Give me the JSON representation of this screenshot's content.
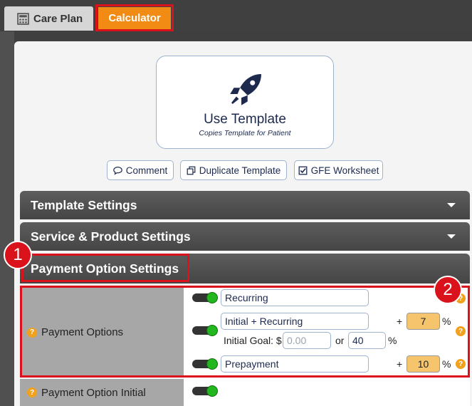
{
  "tabs": [
    {
      "label": "Care Plan",
      "icon": "calculator-icon"
    },
    {
      "label": "Calculator"
    }
  ],
  "template_card": {
    "title": "Use Template",
    "subtitle": "Copies Template for Patient",
    "icon": "rocket-icon"
  },
  "actions": [
    {
      "label": "Comment",
      "icon": "comment-icon"
    },
    {
      "label": "Duplicate Template",
      "icon": "copy-icon"
    },
    {
      "label": "GFE Worksheet",
      "icon": "checkbox-icon"
    }
  ],
  "sections": [
    {
      "label": "Template Settings"
    },
    {
      "label": "Service & Product Settings"
    },
    {
      "label": "Payment Option Settings"
    }
  ],
  "annotations": [
    "1",
    "2"
  ],
  "payment_options": {
    "label": "Payment Options",
    "recurring": "Recurring",
    "initial_recurring": "Initial + Recurring",
    "initial_recurring_plus": "+",
    "initial_recurring_pct": "7",
    "pct_symbol": "%",
    "initial_goal_label": "Initial Goal: $",
    "initial_goal_placeholder": "0.00",
    "or_label": "or",
    "initial_goal_pct": "40",
    "prepayment": "Prepayment",
    "prepayment_plus": "+",
    "prepayment_pct": "10"
  },
  "payment_option_initial": {
    "label": "Payment Option Initial"
  },
  "colors": {
    "accent_orange": "#f28b13",
    "highlight_red": "#d9121b",
    "toggle_green": "#22b61f",
    "navy": "#1d2a4e"
  }
}
